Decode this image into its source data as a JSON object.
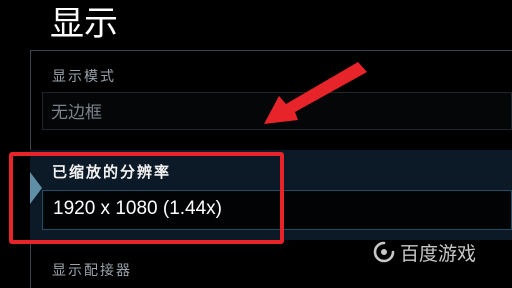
{
  "page": {
    "title": "显示"
  },
  "settings": {
    "display_mode": {
      "label": "显示模式",
      "value": "无边框"
    },
    "scaled_resolution": {
      "label": "已缩放的分辨率",
      "value": "1920 x 1080 (1.44x)"
    },
    "display_adapter": {
      "label": "显示配接器"
    }
  },
  "annotation": {
    "highlight_color": "#e8242b",
    "arrow_color": "#e8242b"
  },
  "watermark": {
    "text": "百度游戏"
  },
  "colors": {
    "background": "#000000",
    "selected_background": "#0b1a26",
    "accent": "#5f8fa6"
  }
}
